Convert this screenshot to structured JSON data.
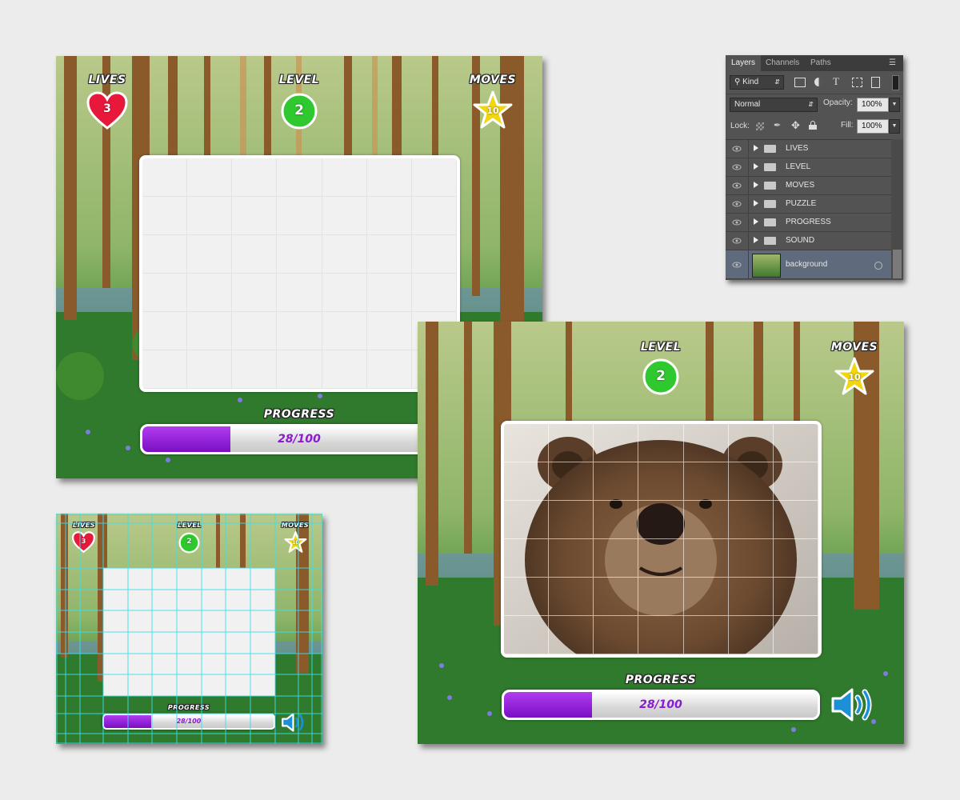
{
  "hud": {
    "lives_label": "LIVES",
    "lives_value": "3",
    "level_label": "LEVEL",
    "level_value": "2",
    "moves_label": "MOVES",
    "moves_value": "10",
    "progress_label": "PROGRESS",
    "progress_text": "28/100",
    "progress_fraction": 0.28
  },
  "puzzle": {
    "columns": 7,
    "rows": 6
  },
  "colors": {
    "heart": "#e8183a",
    "level_badge": "#2fc92f",
    "star": "#f2d60f",
    "progress_fill": "#8b17d6",
    "sound_icon": "#1d8fd6"
  },
  "layers_panel": {
    "tabs": [
      "Layers",
      "Channels",
      "Paths"
    ],
    "filter_kind": "Kind",
    "blend_mode": "Normal",
    "opacity_label": "Opacity:",
    "opacity_value": "100%",
    "lock_label": "Lock:",
    "fill_label": "Fill:",
    "fill_value": "100%",
    "layers": [
      "LIVES",
      "LEVEL",
      "MOVES",
      "PUZZLE",
      "PROGRESS",
      "SOUND",
      "background"
    ]
  }
}
